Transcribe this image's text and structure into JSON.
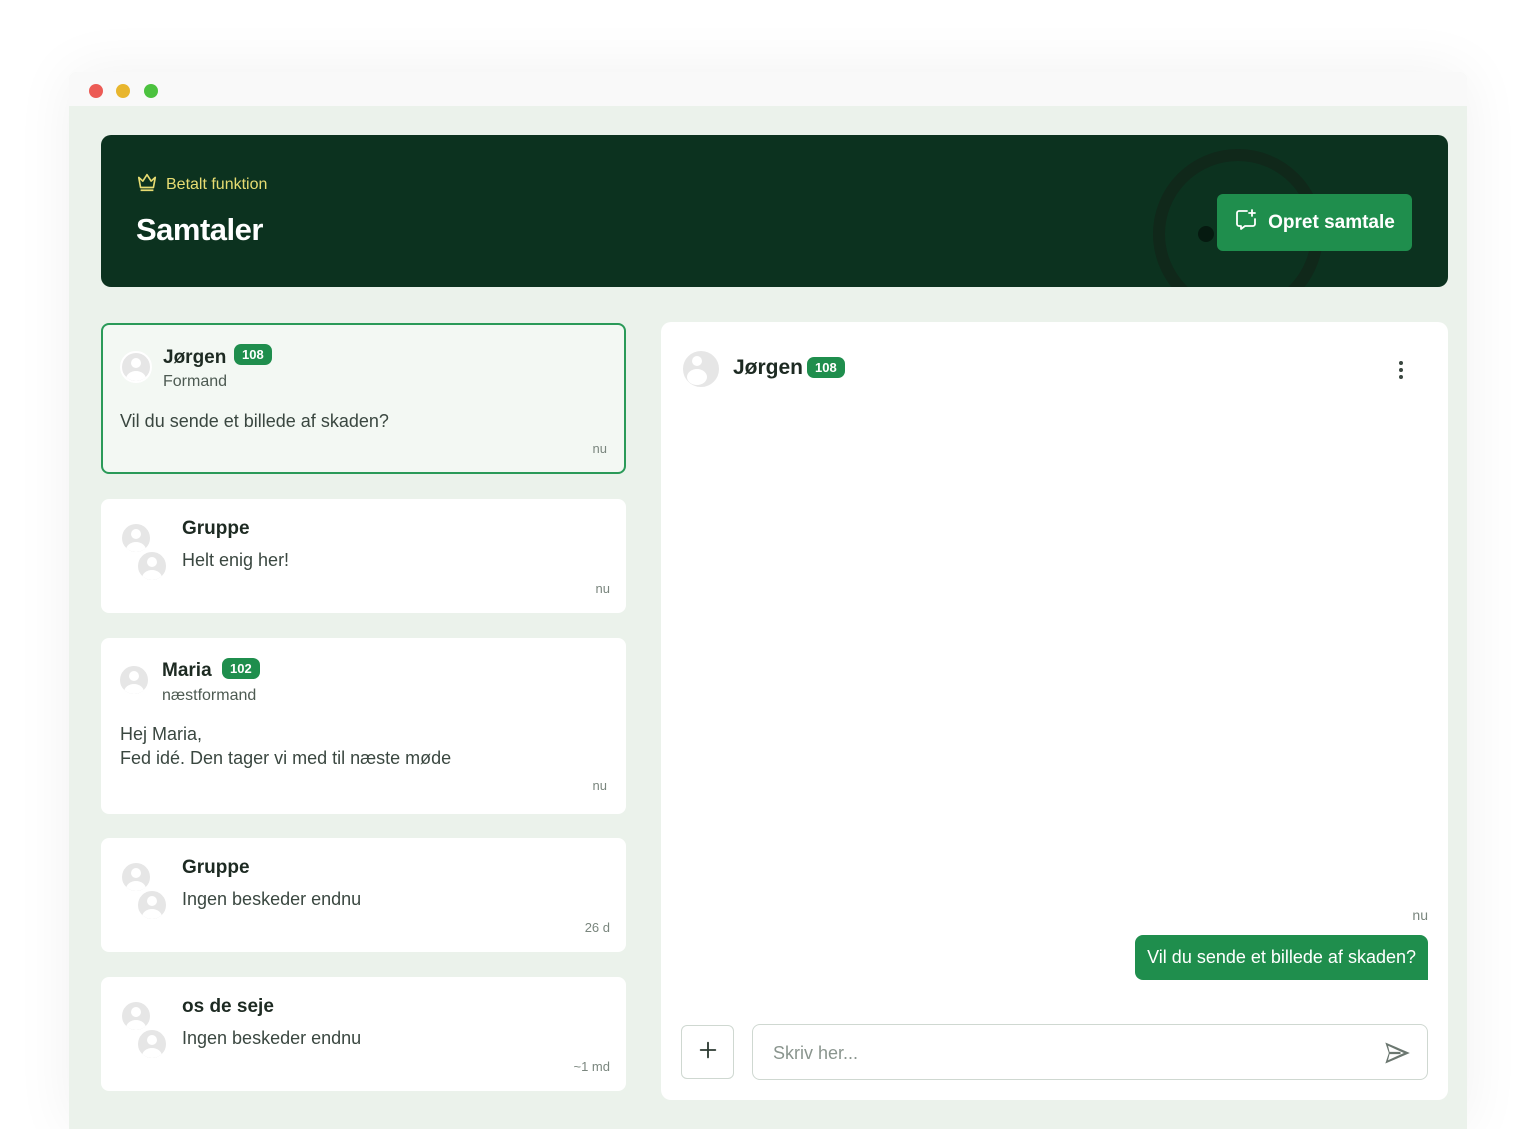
{
  "header": {
    "paid_label": "Betalt funktion",
    "title": "Samtaler",
    "create_button": "Opret samtale"
  },
  "conversations": [
    {
      "name": "Jørgen",
      "badge": "108",
      "role": "Formand",
      "message": "Vil du sende et billede af skaden?",
      "time": "nu",
      "active": true
    },
    {
      "name": "Gruppe",
      "message": "Helt enig her!",
      "time": "nu"
    },
    {
      "name": "Maria",
      "badge": "102",
      "role": "næstformand",
      "message": "Hej Maria,\nFed idé. Den tager vi med til næste møde",
      "time": "nu"
    },
    {
      "name": "Gruppe",
      "message": "Ingen beskeder endnu",
      "time": "26 d"
    },
    {
      "name": "os de seje",
      "message": "Ingen beskeder endnu",
      "time": "~1 md"
    }
  ],
  "chat": {
    "name": "Jørgen",
    "badge": "108",
    "messages": [
      {
        "time": "nu",
        "text": "Vil du sende et billede af skaden?"
      }
    ],
    "input_placeholder": "Skriv her..."
  },
  "colors": {
    "accent": "#1f8e4d",
    "hero_bg": "#0c321f",
    "page_bg": "#ebf2eb",
    "paid_label": "#e7dc72"
  },
  "icons": [
    "crown-icon",
    "chat-plus-icon",
    "kebab-menu-icon",
    "plus-icon",
    "send-icon",
    "avatar-icon"
  ]
}
